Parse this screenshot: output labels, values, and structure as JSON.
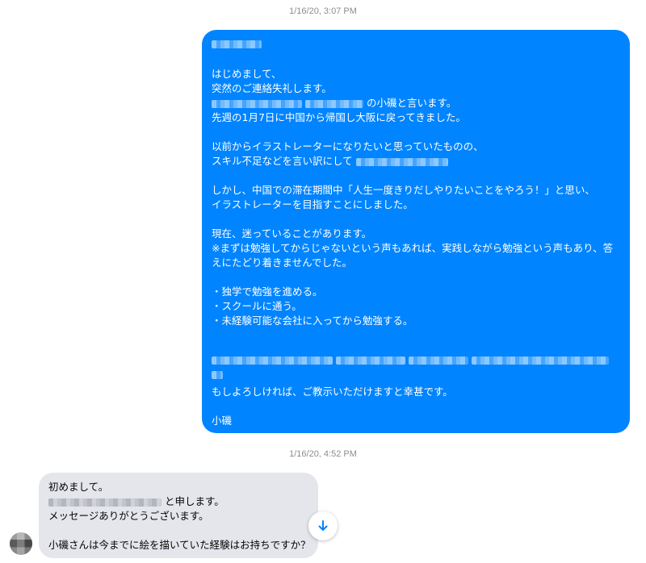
{
  "timestamps": {
    "first": "1/16/20, 3:07 PM",
    "second": "1/16/20, 4:52 PM"
  },
  "outgoing_message": {
    "line_greeting": "はじめまして、",
    "line_apology": "突然のご連絡失礼します。",
    "line_intro_suffix": "の小磯と言います。",
    "line_return": "先週の1月7日に中国から帰国し大阪に戻ってきました。",
    "line_wish": "以前からイラストレーターになりたいと思っていたものの、",
    "line_excuse_prefix": "スキル不足などを言い訳にして",
    "line_decide_1": "しかし、中国での滞在期間中「人生一度きりだしやりたいことをやろう！」と思い、",
    "line_decide_2": "イラストレーターを目指すことにしました。",
    "line_current": "現在、迷っていることがあります。",
    "line_note_1": "※まずは勉強してからじゃないという声もあれば、実践しながら勉強という声もあり、答",
    "line_note_2": "えにたどり着きませんでした。",
    "option_1": "・独学で勉強を進める。",
    "option_2": "・スクールに通う。",
    "option_3": "・未経験可能な会社に入ってから勉強する。",
    "line_request": "もしよろしければ、ご教示いただけますと幸甚です。",
    "signature": "小磯"
  },
  "incoming_message": {
    "line_1": "初めまして。",
    "line_2_suffix": "と申します。",
    "line_3": "メッセージありがとうございます。",
    "line_4": "小磯さんは今までに絵を描いていた経験はお持ちですか？"
  },
  "icons": {
    "scroll_down": "arrow-down-icon",
    "avatar": "avatar"
  },
  "colors": {
    "outgoing_bubble": "#0084ff",
    "incoming_bubble": "#e4e6eb",
    "timestamp": "#8a8d91"
  }
}
